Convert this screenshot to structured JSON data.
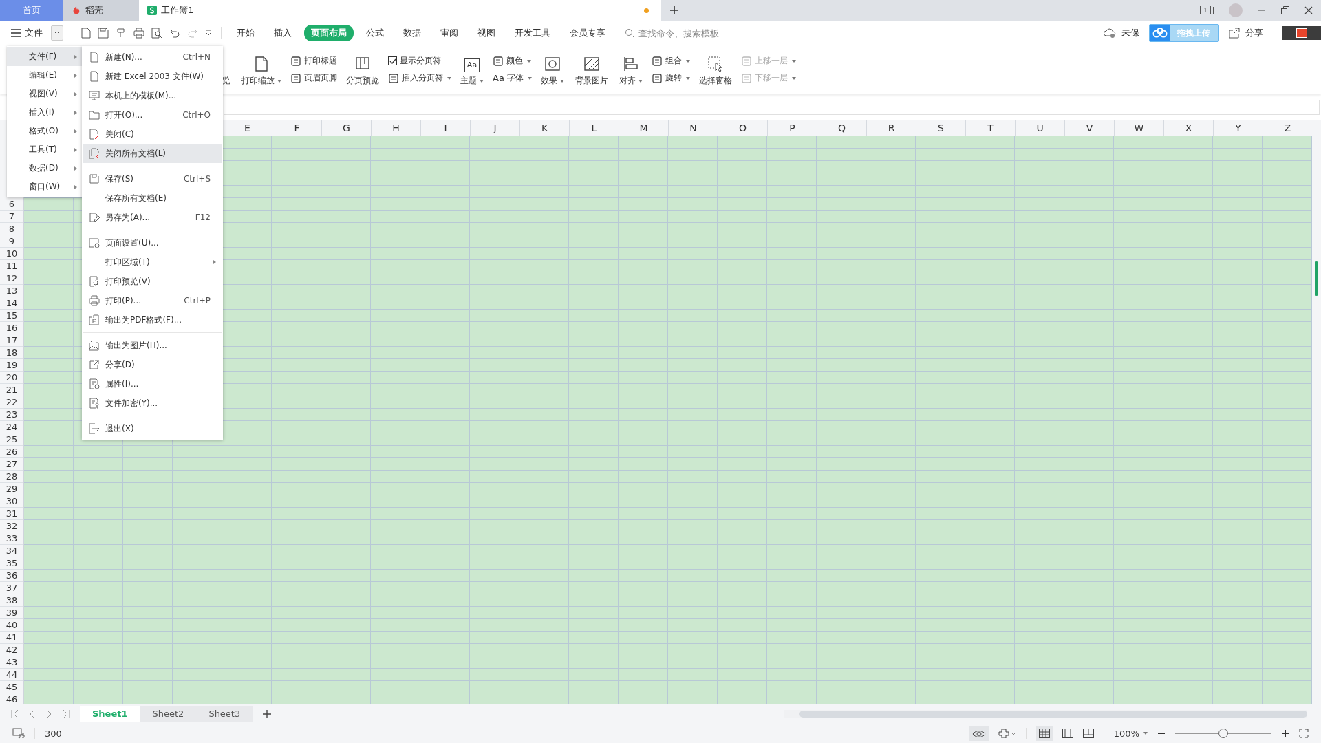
{
  "tabs": [
    {
      "label": "首页",
      "kind": "home",
      "selected": false
    },
    {
      "label": "稻壳",
      "kind": "docer",
      "selected": false
    },
    {
      "label": "工作簿1",
      "kind": "sheet",
      "selected": true,
      "unsaved": true
    }
  ],
  "menu_button": "文件",
  "ribbon_tabs": [
    {
      "label": "开始",
      "selected": false
    },
    {
      "label": "插入",
      "selected": false
    },
    {
      "label": "页面布局",
      "selected": true
    },
    {
      "label": "公式",
      "selected": false
    },
    {
      "label": "数据",
      "selected": false
    },
    {
      "label": "审阅",
      "selected": false
    },
    {
      "label": "视图",
      "selected": false
    },
    {
      "label": "开发工具",
      "selected": false
    },
    {
      "label": "会员专享",
      "selected": false
    }
  ],
  "search": {
    "placeholder": "查找命令、搜索模板"
  },
  "cloud_status": "未保",
  "share": "分享",
  "upload_widget": "拖拽上传",
  "ribbon": [
    {
      "kind": "big",
      "label": "览"
    },
    {
      "kind": "big",
      "label": "打印缩放",
      "dropdown": true
    },
    {
      "kind": "stack",
      "items": [
        {
          "label": "打印标题"
        },
        {
          "label": "页眉页脚"
        }
      ]
    },
    {
      "kind": "big",
      "label": "分页预览"
    },
    {
      "kind": "stack",
      "items": [
        {
          "label": "显示分页符",
          "kind": "checkbox",
          "checked": true
        },
        {
          "label": "插入分页符",
          "dropdown": true
        }
      ]
    },
    {
      "kind": "big",
      "label": "主题",
      "dropdown": true,
      "icon_text": "Aa"
    },
    {
      "kind": "stack",
      "items": [
        {
          "label": "颜色",
          "dropdown": true
        },
        {
          "label": "字体",
          "dropdown": true,
          "icon_text": "Aa"
        }
      ]
    },
    {
      "kind": "big",
      "label": "效果",
      "dropdown": true
    },
    {
      "kind": "big",
      "label": "背景图片"
    },
    {
      "kind": "big",
      "label": "对齐",
      "dropdown": true
    },
    {
      "kind": "stack",
      "items": [
        {
          "label": "组合",
          "dropdown": true
        },
        {
          "label": "旋转",
          "dropdown": true
        }
      ]
    },
    {
      "kind": "big",
      "label": "选择窗格"
    },
    {
      "kind": "stack",
      "items": [
        {
          "label": "上移一层",
          "dropdown": true,
          "disabled": true
        },
        {
          "label": "下移一层",
          "dropdown": true,
          "disabled": true
        }
      ]
    }
  ],
  "menu": [
    {
      "label": "文件(F)",
      "selected": true
    },
    {
      "label": "编辑(E)",
      "selected": false
    },
    {
      "label": "视图(V)",
      "selected": false
    },
    {
      "label": "插入(I)",
      "selected": false
    },
    {
      "label": "格式(O)",
      "selected": false
    },
    {
      "label": "工具(T)",
      "selected": false
    },
    {
      "label": "数据(D)",
      "selected": false
    },
    {
      "label": "窗口(W)",
      "selected": false
    }
  ],
  "submenu": [
    [
      {
        "label": "新建(N)...",
        "shortcut": "Ctrl+N",
        "selected": false
      },
      {
        "label": "新建 Excel 2003 文件(W)",
        "selected": false
      },
      {
        "label": "本机上的模板(M)...",
        "selected": false
      },
      {
        "label": "打开(O)...",
        "shortcut": "Ctrl+O",
        "selected": false
      },
      {
        "label": "关闭(C)",
        "selected": false
      },
      {
        "label": "关闭所有文档(L)",
        "selected": true
      }
    ],
    [
      {
        "label": "保存(S)",
        "shortcut": "Ctrl+S",
        "selected": false
      },
      {
        "label": "保存所有文档(E)",
        "selected": false
      },
      {
        "label": "另存为(A)...",
        "shortcut": "F12",
        "selected": false
      }
    ],
    [
      {
        "label": "页面设置(U)...",
        "selected": false
      },
      {
        "label": "打印区域(T)",
        "has_submenu": true,
        "selected": false
      },
      {
        "label": "打印预览(V)",
        "selected": false
      },
      {
        "label": "打印(P)...",
        "shortcut": "Ctrl+P",
        "selected": false
      },
      {
        "label": "输出为PDF格式(F)...",
        "selected": false
      }
    ],
    [
      {
        "label": "输出为图片(H)...",
        "selected": false
      },
      {
        "label": "分享(D)",
        "selected": false
      },
      {
        "label": "属性(I)...",
        "selected": false
      },
      {
        "label": "文件加密(Y)...",
        "selected": false
      }
    ],
    [
      {
        "label": "退出(X)",
        "selected": false
      }
    ]
  ],
  "columns": [
    "E",
    "F",
    "G",
    "H",
    "I",
    "J",
    "K",
    "L",
    "M",
    "N",
    "O",
    "P",
    "Q",
    "R",
    "S",
    "T",
    "U",
    "V",
    "W",
    "X",
    "Y",
    "Z"
  ],
  "rows": [
    "6",
    "7",
    "8",
    "9",
    "10",
    "11",
    "12",
    "13",
    "14",
    "15",
    "16",
    "17",
    "18",
    "19",
    "20",
    "21",
    "22",
    "23",
    "24",
    "25",
    "26",
    "27",
    "28",
    "29",
    "30",
    "31",
    "32",
    "33",
    "34",
    "35",
    "36",
    "37",
    "38",
    "39",
    "40",
    "41",
    "42",
    "43",
    "44",
    "45",
    "46"
  ],
  "sheets": [
    {
      "label": "Sheet1",
      "selected": true
    },
    {
      "label": "Sheet2",
      "selected": false
    },
    {
      "label": "Sheet3",
      "selected": false
    }
  ],
  "status": {
    "count": "300",
    "zoom": "100%",
    "level": 0.5
  }
}
